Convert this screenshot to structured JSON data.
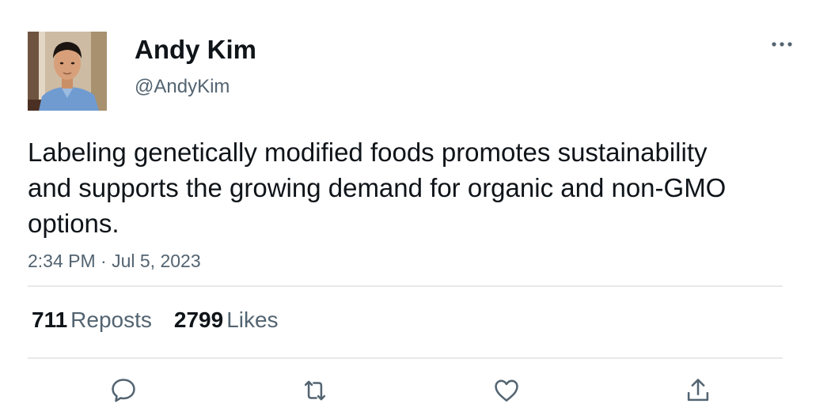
{
  "author": {
    "display_name": "Andy Kim",
    "handle": "@AndyKim",
    "avatar_icon": "profile-photo"
  },
  "tweet": {
    "text": "Labeling genetically modified foods promotes sustainability and supports the growing demand for organic and non-GMO options.",
    "timestamp": "2:34 PM · Jul 5, 2023"
  },
  "stats": {
    "reposts_count": "711",
    "reposts_label": "Reposts",
    "likes_count": "2799",
    "likes_label": "Likes"
  },
  "icons": {
    "more": "more-horizontal-icon",
    "reply": "reply-icon",
    "repost": "repost-icon",
    "like": "heart-icon",
    "share": "share-icon"
  },
  "colors": {
    "text": "#0f1419",
    "secondary_text": "#536471",
    "divider": "#e6e8ea"
  }
}
